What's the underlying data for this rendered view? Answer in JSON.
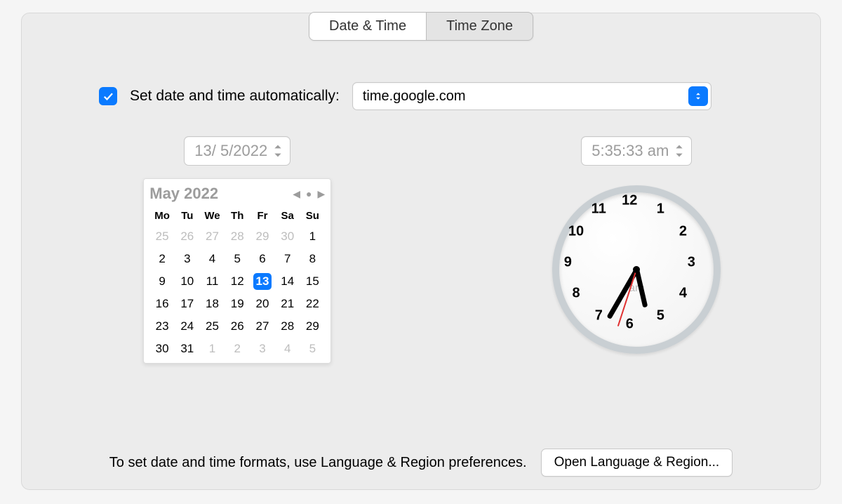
{
  "tabs": {
    "date_time": "Date & Time",
    "time_zone": "Time Zone",
    "active": "date_time"
  },
  "auto": {
    "checked": true,
    "label": "Set date and time automatically:",
    "server": "time.google.com"
  },
  "date_field": "13/  5/2022",
  "time_field": "5:35:33 am",
  "calendar": {
    "title": "May 2022",
    "weekdays": [
      "Mo",
      "Tu",
      "We",
      "Th",
      "Fr",
      "Sa",
      "Su"
    ],
    "selected_day": 13,
    "weeks": [
      [
        {
          "d": 25,
          "o": true
        },
        {
          "d": 26,
          "o": true
        },
        {
          "d": 27,
          "o": true
        },
        {
          "d": 28,
          "o": true
        },
        {
          "d": 29,
          "o": true
        },
        {
          "d": 30,
          "o": true
        },
        {
          "d": 1
        }
      ],
      [
        {
          "d": 2
        },
        {
          "d": 3
        },
        {
          "d": 4
        },
        {
          "d": 5
        },
        {
          "d": 6
        },
        {
          "d": 7
        },
        {
          "d": 8
        }
      ],
      [
        {
          "d": 9
        },
        {
          "d": 10
        },
        {
          "d": 11
        },
        {
          "d": 12
        },
        {
          "d": 13,
          "sel": true
        },
        {
          "d": 14
        },
        {
          "d": 15
        }
      ],
      [
        {
          "d": 16
        },
        {
          "d": 17
        },
        {
          "d": 18
        },
        {
          "d": 19
        },
        {
          "d": 20
        },
        {
          "d": 21
        },
        {
          "d": 22
        }
      ],
      [
        {
          "d": 23
        },
        {
          "d": 24
        },
        {
          "d": 25
        },
        {
          "d": 26
        },
        {
          "d": 27
        },
        {
          "d": 28
        },
        {
          "d": 29
        }
      ],
      [
        {
          "d": 30
        },
        {
          "d": 31
        },
        {
          "d": 1,
          "o": true
        },
        {
          "d": 2,
          "o": true
        },
        {
          "d": 3,
          "o": true
        },
        {
          "d": 4,
          "o": true
        },
        {
          "d": 5,
          "o": true
        }
      ]
    ]
  },
  "clock": {
    "numerals": [
      "12",
      "1",
      "2",
      "3",
      "4",
      "5",
      "6",
      "7",
      "8",
      "9",
      "10",
      "11"
    ],
    "ampm": "am",
    "hour_angle": 167,
    "minute_angle": 210,
    "second_angle": 198
  },
  "footer": {
    "hint": "To set date and time formats, use Language & Region preferences.",
    "button": "Open Language & Region..."
  }
}
